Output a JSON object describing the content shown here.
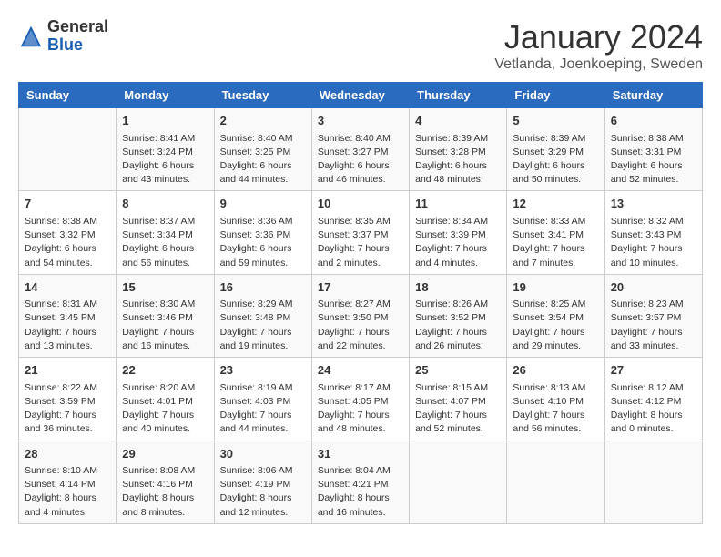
{
  "header": {
    "logo_general": "General",
    "logo_blue": "Blue",
    "month_title": "January 2024",
    "location": "Vetlanda, Joenkoeping, Sweden"
  },
  "days_of_week": [
    "Sunday",
    "Monday",
    "Tuesday",
    "Wednesday",
    "Thursday",
    "Friday",
    "Saturday"
  ],
  "weeks": [
    [
      {
        "day": "",
        "info": ""
      },
      {
        "day": "1",
        "info": "Sunrise: 8:41 AM\nSunset: 3:24 PM\nDaylight: 6 hours\nand 43 minutes."
      },
      {
        "day": "2",
        "info": "Sunrise: 8:40 AM\nSunset: 3:25 PM\nDaylight: 6 hours\nand 44 minutes."
      },
      {
        "day": "3",
        "info": "Sunrise: 8:40 AM\nSunset: 3:27 PM\nDaylight: 6 hours\nand 46 minutes."
      },
      {
        "day": "4",
        "info": "Sunrise: 8:39 AM\nSunset: 3:28 PM\nDaylight: 6 hours\nand 48 minutes."
      },
      {
        "day": "5",
        "info": "Sunrise: 8:39 AM\nSunset: 3:29 PM\nDaylight: 6 hours\nand 50 minutes."
      },
      {
        "day": "6",
        "info": "Sunrise: 8:38 AM\nSunset: 3:31 PM\nDaylight: 6 hours\nand 52 minutes."
      }
    ],
    [
      {
        "day": "7",
        "info": "Sunrise: 8:38 AM\nSunset: 3:32 PM\nDaylight: 6 hours\nand 54 minutes."
      },
      {
        "day": "8",
        "info": "Sunrise: 8:37 AM\nSunset: 3:34 PM\nDaylight: 6 hours\nand 56 minutes."
      },
      {
        "day": "9",
        "info": "Sunrise: 8:36 AM\nSunset: 3:36 PM\nDaylight: 6 hours\nand 59 minutes."
      },
      {
        "day": "10",
        "info": "Sunrise: 8:35 AM\nSunset: 3:37 PM\nDaylight: 7 hours\nand 2 minutes."
      },
      {
        "day": "11",
        "info": "Sunrise: 8:34 AM\nSunset: 3:39 PM\nDaylight: 7 hours\nand 4 minutes."
      },
      {
        "day": "12",
        "info": "Sunrise: 8:33 AM\nSunset: 3:41 PM\nDaylight: 7 hours\nand 7 minutes."
      },
      {
        "day": "13",
        "info": "Sunrise: 8:32 AM\nSunset: 3:43 PM\nDaylight: 7 hours\nand 10 minutes."
      }
    ],
    [
      {
        "day": "14",
        "info": "Sunrise: 8:31 AM\nSunset: 3:45 PM\nDaylight: 7 hours\nand 13 minutes."
      },
      {
        "day": "15",
        "info": "Sunrise: 8:30 AM\nSunset: 3:46 PM\nDaylight: 7 hours\nand 16 minutes."
      },
      {
        "day": "16",
        "info": "Sunrise: 8:29 AM\nSunset: 3:48 PM\nDaylight: 7 hours\nand 19 minutes."
      },
      {
        "day": "17",
        "info": "Sunrise: 8:27 AM\nSunset: 3:50 PM\nDaylight: 7 hours\nand 22 minutes."
      },
      {
        "day": "18",
        "info": "Sunrise: 8:26 AM\nSunset: 3:52 PM\nDaylight: 7 hours\nand 26 minutes."
      },
      {
        "day": "19",
        "info": "Sunrise: 8:25 AM\nSunset: 3:54 PM\nDaylight: 7 hours\nand 29 minutes."
      },
      {
        "day": "20",
        "info": "Sunrise: 8:23 AM\nSunset: 3:57 PM\nDaylight: 7 hours\nand 33 minutes."
      }
    ],
    [
      {
        "day": "21",
        "info": "Sunrise: 8:22 AM\nSunset: 3:59 PM\nDaylight: 7 hours\nand 36 minutes."
      },
      {
        "day": "22",
        "info": "Sunrise: 8:20 AM\nSunset: 4:01 PM\nDaylight: 7 hours\nand 40 minutes."
      },
      {
        "day": "23",
        "info": "Sunrise: 8:19 AM\nSunset: 4:03 PM\nDaylight: 7 hours\nand 44 minutes."
      },
      {
        "day": "24",
        "info": "Sunrise: 8:17 AM\nSunset: 4:05 PM\nDaylight: 7 hours\nand 48 minutes."
      },
      {
        "day": "25",
        "info": "Sunrise: 8:15 AM\nSunset: 4:07 PM\nDaylight: 7 hours\nand 52 minutes."
      },
      {
        "day": "26",
        "info": "Sunrise: 8:13 AM\nSunset: 4:10 PM\nDaylight: 7 hours\nand 56 minutes."
      },
      {
        "day": "27",
        "info": "Sunrise: 8:12 AM\nSunset: 4:12 PM\nDaylight: 8 hours\nand 0 minutes."
      }
    ],
    [
      {
        "day": "28",
        "info": "Sunrise: 8:10 AM\nSunset: 4:14 PM\nDaylight: 8 hours\nand 4 minutes."
      },
      {
        "day": "29",
        "info": "Sunrise: 8:08 AM\nSunset: 4:16 PM\nDaylight: 8 hours\nand 8 minutes."
      },
      {
        "day": "30",
        "info": "Sunrise: 8:06 AM\nSunset: 4:19 PM\nDaylight: 8 hours\nand 12 minutes."
      },
      {
        "day": "31",
        "info": "Sunrise: 8:04 AM\nSunset: 4:21 PM\nDaylight: 8 hours\nand 16 minutes."
      },
      {
        "day": "",
        "info": ""
      },
      {
        "day": "",
        "info": ""
      },
      {
        "day": "",
        "info": ""
      }
    ]
  ]
}
